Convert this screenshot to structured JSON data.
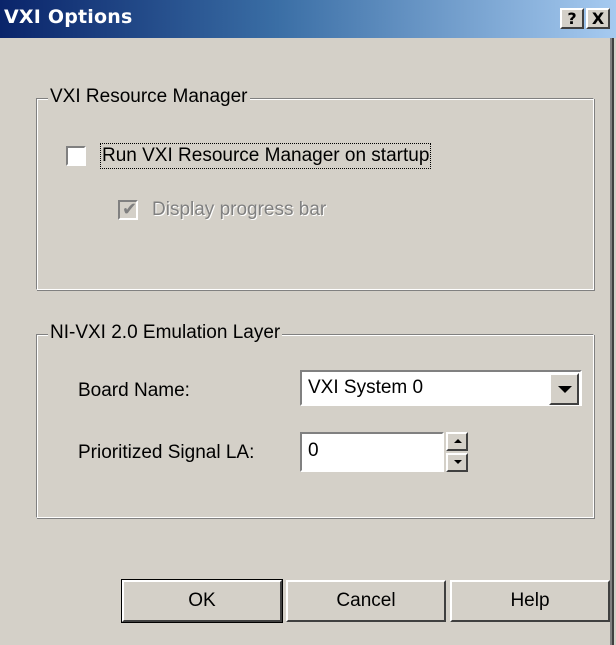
{
  "window": {
    "title": "VXI Options",
    "help_button_label": "?",
    "close_button_label": "X"
  },
  "resource_manager": {
    "group_label": "VXI Resource Manager",
    "run_on_startup_label": "Run VXI Resource Manager on startup",
    "run_on_startup_checked": false,
    "display_progress_label": "Display progress bar",
    "display_progress_checked": true,
    "display_progress_enabled": false
  },
  "emulation_layer": {
    "group_label": "NI-VXI 2.0 Emulation Layer",
    "board_name_label": "Board Name:",
    "board_name_value": "VXI System 0",
    "prioritized_signal_label": "Prioritized Signal LA:",
    "prioritized_signal_value": "0"
  },
  "buttons": {
    "ok_label": "OK",
    "cancel_label": "Cancel",
    "help_label": "Help"
  },
  "colors": {
    "title_gradient_start": "#0a246a",
    "title_gradient_end": "#a6caf0",
    "face": "#d4d0c8",
    "disabled_text": "#808080"
  }
}
